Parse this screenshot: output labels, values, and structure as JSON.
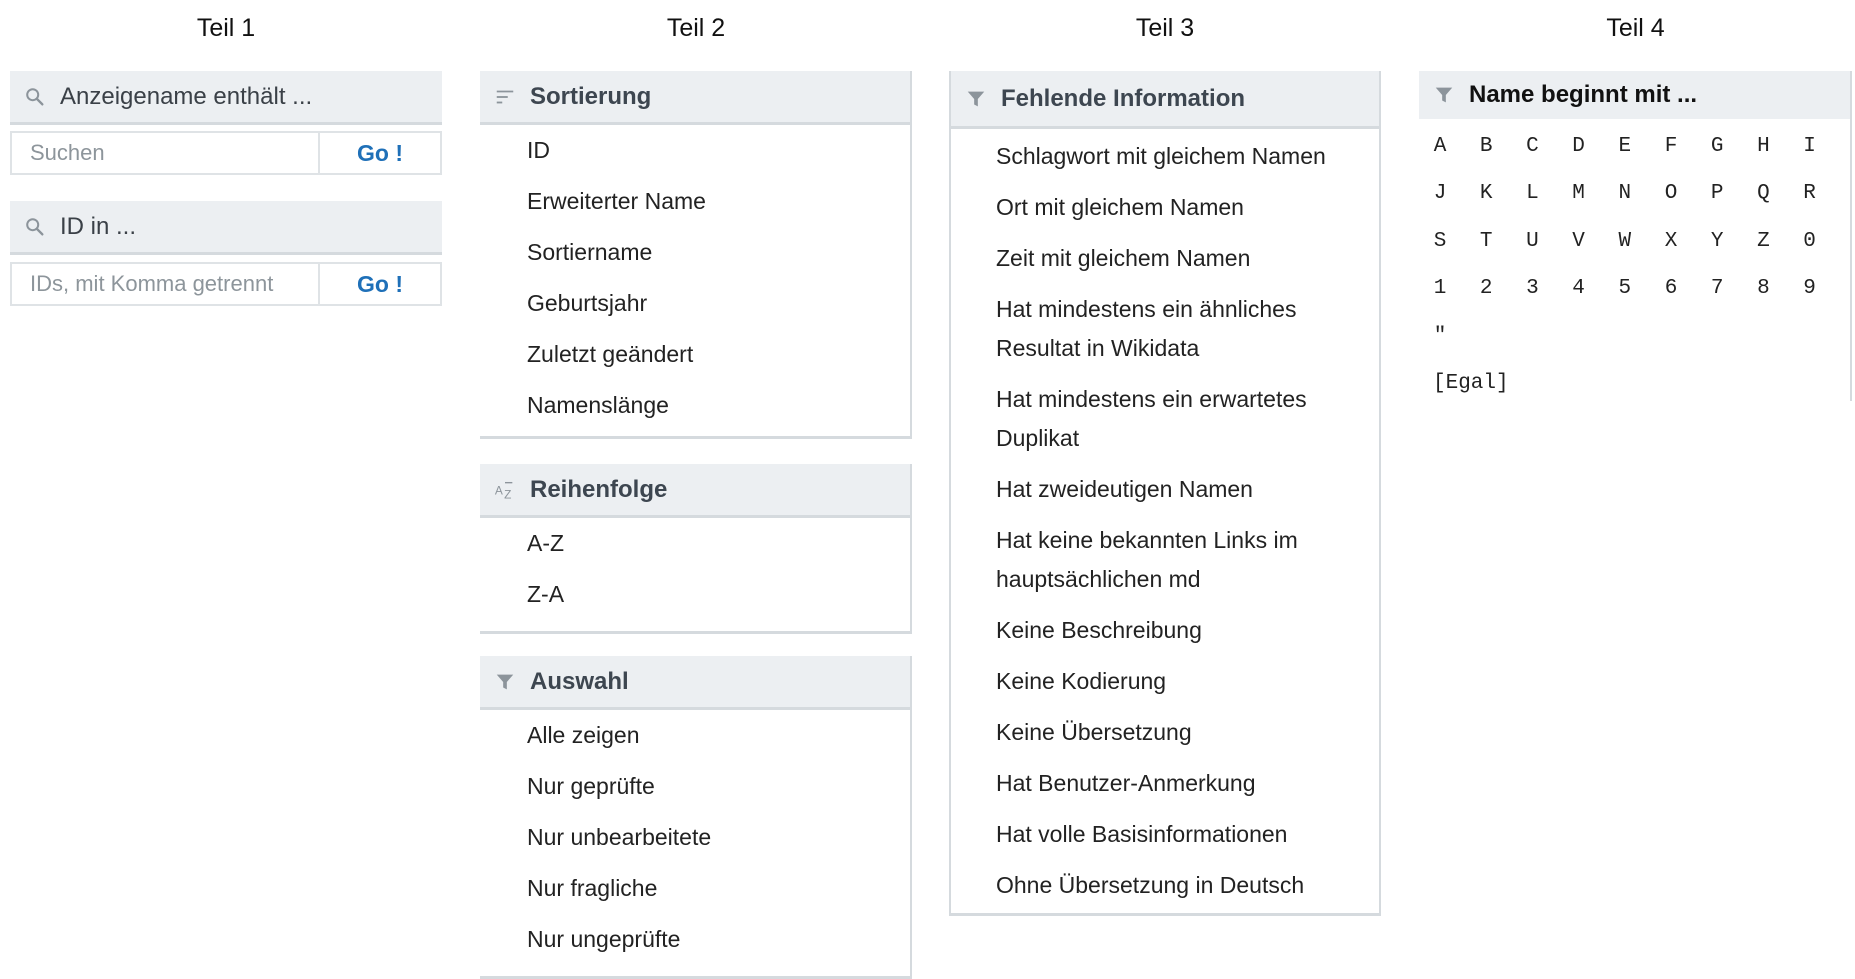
{
  "columns": {
    "c1": "Teil 1",
    "c2": "Teil 2",
    "c3": "Teil 3",
    "c4": "Teil 4"
  },
  "teil1": {
    "name_filter": {
      "title": "Anzeigename enthält ...",
      "placeholder": "Suchen",
      "go": "Go !"
    },
    "id_filter": {
      "title": "ID in ...",
      "placeholder": "IDs, mit Komma getrennt",
      "go": "Go !"
    }
  },
  "teil2": {
    "sort": {
      "title": "Sortierung",
      "items": [
        "ID",
        "Erweiterter Name",
        "Sortiername",
        "Geburtsjahr",
        "Zuletzt geändert",
        "Namenslänge"
      ]
    },
    "order": {
      "title": "Reihenfolge",
      "items": [
        "A-Z",
        "Z-A"
      ]
    },
    "selection": {
      "title": "Auswahl",
      "items": [
        "Alle zeigen",
        "Nur geprüfte",
        "Nur unbearbeitete",
        "Nur fragliche",
        "Nur ungeprüfte"
      ]
    }
  },
  "teil3": {
    "title": "Fehlende Information",
    "items": [
      "Schlagwort mit gleichem Namen",
      "Ort mit gleichem Namen",
      "Zeit mit gleichem Namen",
      "Hat mindestens ein ähnliches",
      "Resultat in Wikidata",
      "Hat mindestens ein erwartetes",
      "Duplikat",
      "Hat zweideutigen Namen",
      "Hat keine bekannten Links im",
      "hauptsächlichen md",
      "Keine Beschreibung",
      "Keine Kodierung",
      "Keine Übersetzung",
      "Hat Benutzer-Anmerkung",
      "Hat volle Basisinformationen",
      "Ohne Übersetzung in Deutsch"
    ]
  },
  "teil4": {
    "title": "Name beginnt mit ...",
    "letters": [
      "A",
      "B",
      "C",
      "D",
      "E",
      "F",
      "G",
      "H",
      "I",
      "J",
      "K",
      "L",
      "M",
      "N",
      "O",
      "P",
      "Q",
      "R",
      "S",
      "T",
      "U",
      "V",
      "W",
      "X",
      "Y",
      "Z",
      "0",
      "1",
      "2",
      "3",
      "4",
      "5",
      "6",
      "7",
      "8",
      "9",
      "\""
    ],
    "egal": "[Egal]"
  },
  "icons": {
    "search": "search-icon",
    "sort": "sort-lines-icon",
    "az": "az-sort-icon",
    "filter": "filter-funnel-icon"
  }
}
